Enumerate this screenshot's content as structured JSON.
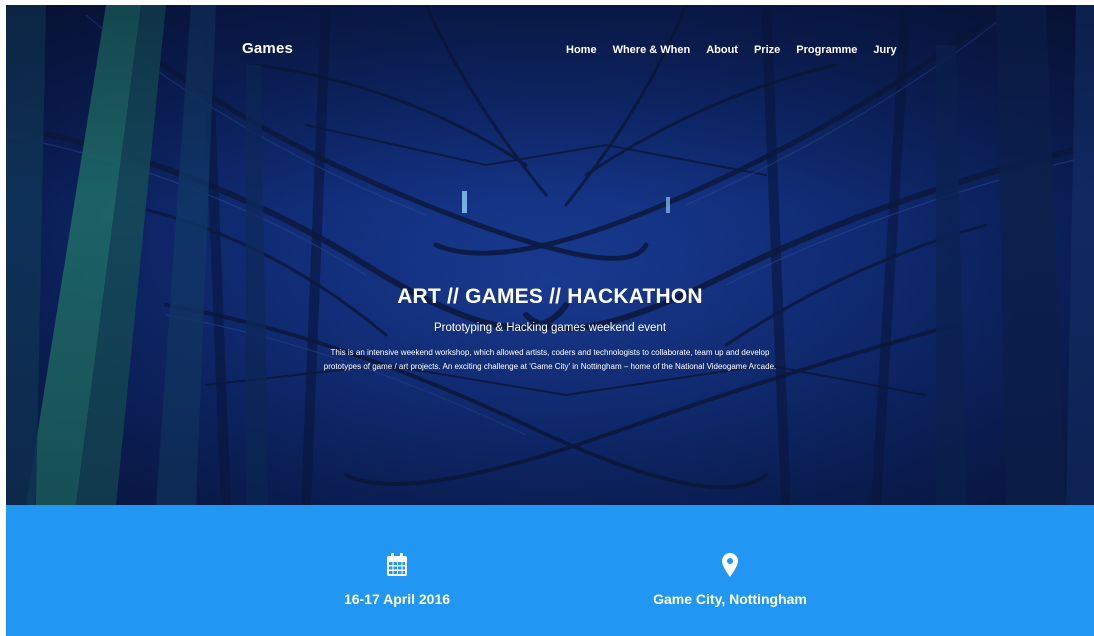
{
  "header": {
    "brand": "Games",
    "nav": [
      {
        "label": "Home"
      },
      {
        "label": "Where & When"
      },
      {
        "label": "About"
      },
      {
        "label": "Prize"
      },
      {
        "label": "Programme"
      },
      {
        "label": "Jury"
      }
    ]
  },
  "hero": {
    "title": "ART // GAMES // HACKATHON",
    "subtitle": "Prototyping & Hacking games weekend event",
    "description_line1": "This is an intensive weekend workshop, which allowed artists, coders and technologists to collaborate, team up and develop",
    "description_line2": "prototypes of game / art projects. An exciting challenge at 'Game City' in Nottingham – home of the National Videogame Arcade."
  },
  "info": {
    "date": {
      "icon": "calendar-icon",
      "label": "16-17 April 2016"
    },
    "location": {
      "icon": "map-marker-icon",
      "label": "Game City, Nottingham"
    }
  },
  "colors": {
    "accent": "#2196f3",
    "hero_dark": "#0b1f58"
  }
}
